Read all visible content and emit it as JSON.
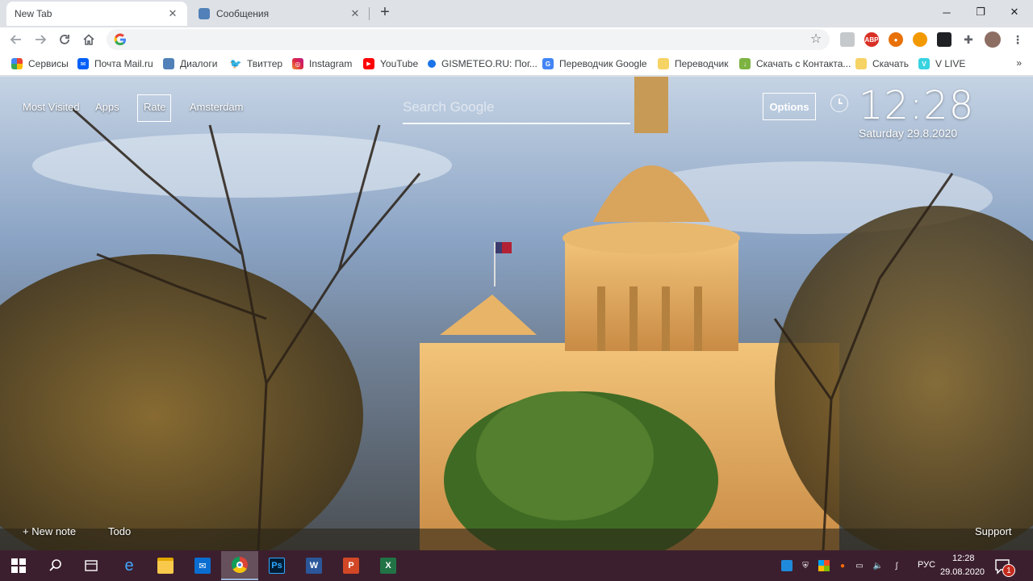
{
  "tabs": [
    {
      "title": "New Tab",
      "active": true,
      "icon": "none"
    },
    {
      "title": "Сообщения",
      "active": false,
      "icon": "chat-icon"
    }
  ],
  "toolbar": {
    "omnibox_value": "",
    "omnibox_placeholder": ""
  },
  "bookmarks": [
    {
      "label": "Сервисы",
      "icon": "apps-grid-icon"
    },
    {
      "label": "Почта Mail.ru",
      "icon": "mail-icon"
    },
    {
      "label": "Диалоги",
      "icon": "chat-icon"
    },
    {
      "label": "Твиттер",
      "icon": "twitter-icon"
    },
    {
      "label": "Instagram",
      "icon": "instagram-icon"
    },
    {
      "label": "YouTube",
      "icon": "youtube-icon"
    },
    {
      "label": "GISMETEO.RU: Пог...",
      "icon": "gismeteo-icon"
    },
    {
      "label": "Переводчик Google",
      "icon": "google-translate-icon"
    },
    {
      "label": "Переводчик",
      "icon": "folder-icon"
    },
    {
      "label": "Скачать с Контакта...",
      "icon": "download-icon"
    },
    {
      "label": "Скачать",
      "icon": "folder-icon"
    },
    {
      "label": "V LIVE",
      "icon": "vlive-icon"
    }
  ],
  "bookmarks_more": "»",
  "page": {
    "nav": {
      "most_visited": "Most Visited",
      "apps": "Apps",
      "rate": "Rate",
      "location": "Amsterdam"
    },
    "search_placeholder": "Search Google",
    "search_value": "",
    "options_label": "Options",
    "clock": {
      "time": "12:28",
      "date": "Saturday  29.8.2020"
    },
    "footer": {
      "new_note": "+ New note",
      "todo": "Todo",
      "support": "Support"
    }
  },
  "taskbar": {
    "apps": [
      {
        "name": "start",
        "icon": "windows-icon"
      },
      {
        "name": "search",
        "icon": "search-icon"
      },
      {
        "name": "task-view",
        "icon": "task-view-icon"
      },
      {
        "name": "edge",
        "icon": "edge-icon"
      },
      {
        "name": "file-explorer",
        "icon": "folder-icon"
      },
      {
        "name": "mail",
        "icon": "mail-icon"
      },
      {
        "name": "chrome",
        "icon": "chrome-icon",
        "active": true
      },
      {
        "name": "photoshop",
        "icon": "photoshop-icon",
        "label": "Ps"
      },
      {
        "name": "word",
        "icon": "word-icon",
        "label": "W"
      },
      {
        "name": "powerpoint",
        "icon": "powerpoint-icon",
        "label": "P"
      },
      {
        "name": "excel",
        "icon": "excel-icon",
        "label": "X"
      }
    ],
    "tray": {
      "language": "РУС",
      "time": "12:28",
      "date": "29.08.2020",
      "notification_count": "1"
    }
  },
  "colors": {
    "taskbar": "#3c1f2e",
    "tab_strip": "#dee1e6",
    "chrome_accent": "#1a73e8"
  }
}
